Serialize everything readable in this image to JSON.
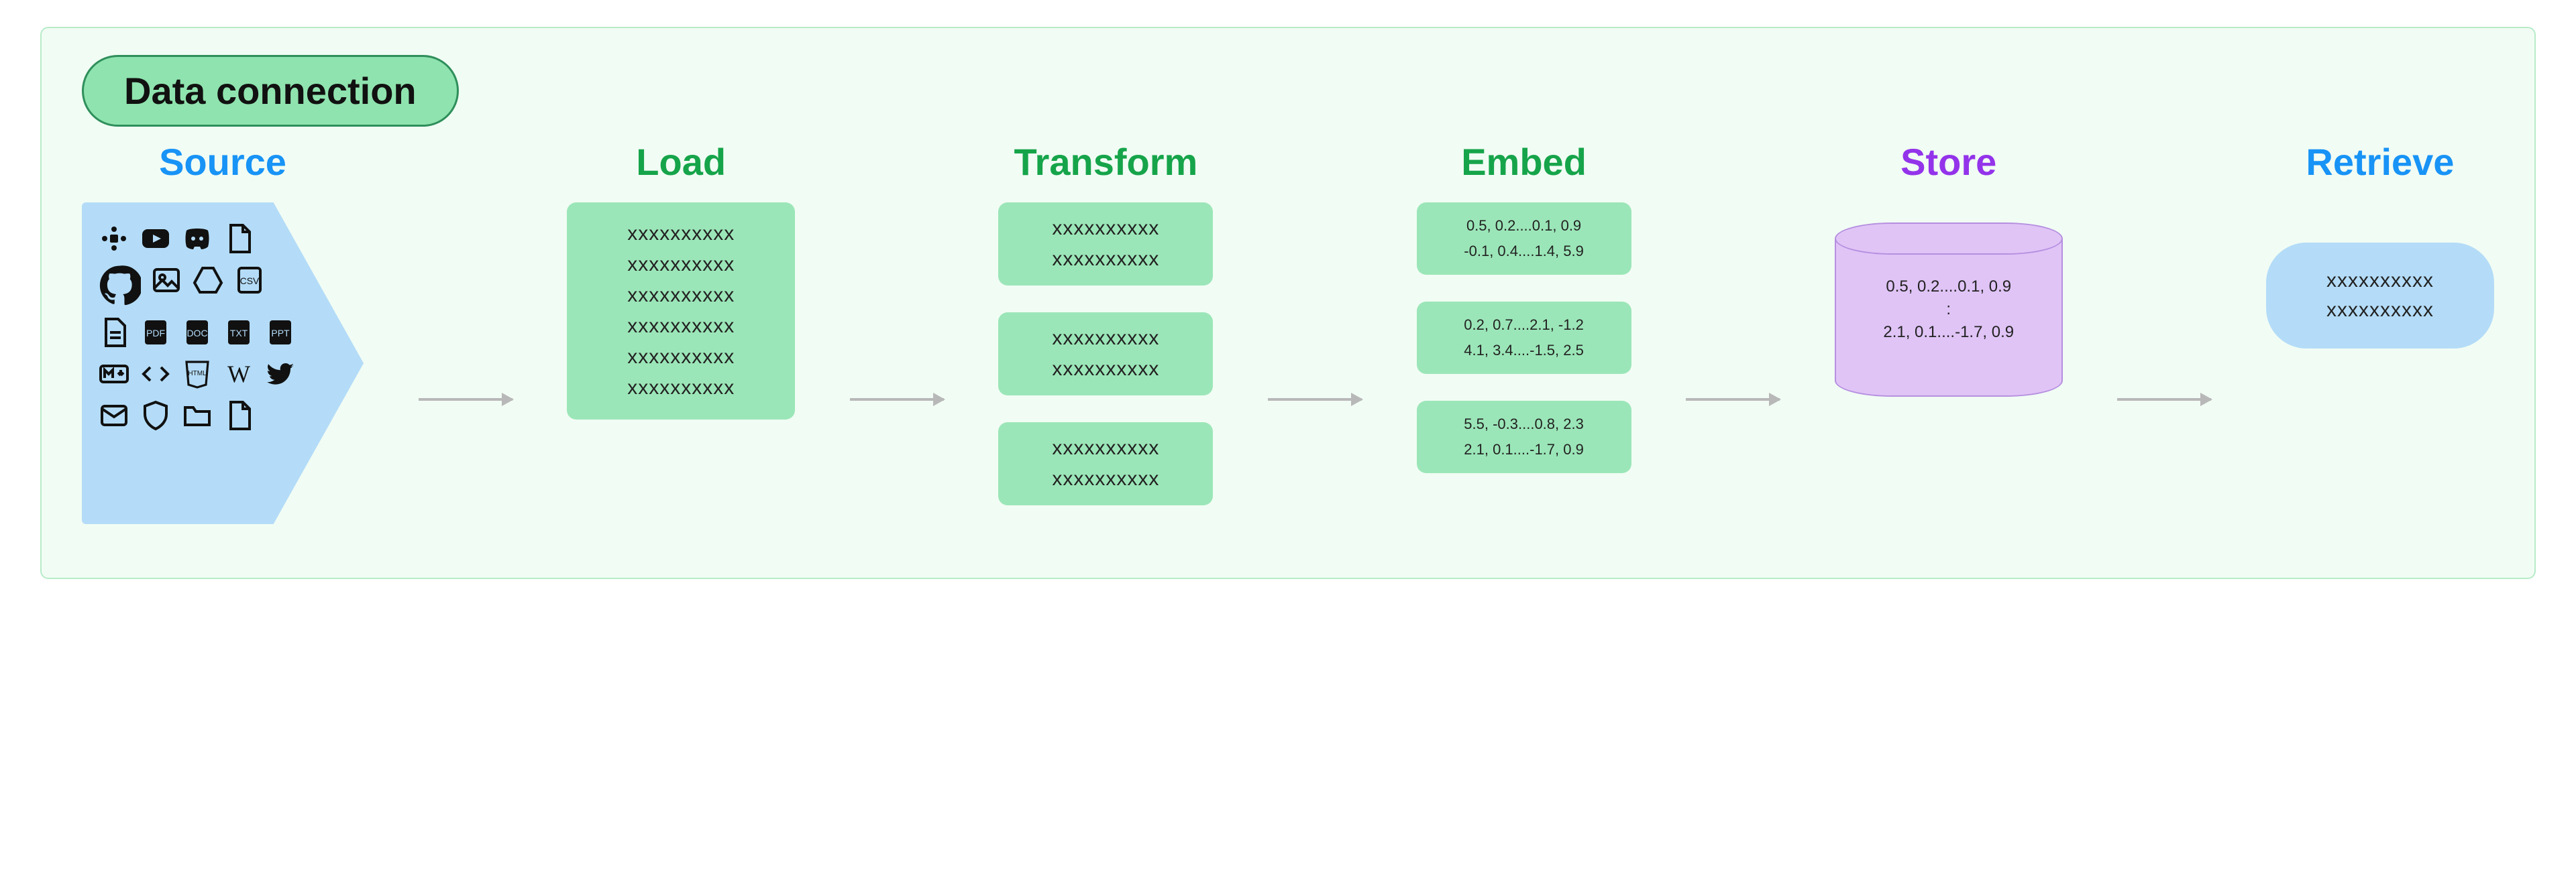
{
  "badge": "Data connection",
  "stages": {
    "source": {
      "title": "Source"
    },
    "load": {
      "title": "Load"
    },
    "transform": {
      "title": "Transform"
    },
    "embed": {
      "title": "Embed"
    },
    "store": {
      "title": "Store"
    },
    "retrieve": {
      "title": "Retrieve"
    }
  },
  "x": "xxxxxxxxxx",
  "load_lines": [
    "xxxxxxxxxx",
    "xxxxxxxxxx",
    "xxxxxxxxxx",
    "xxxxxxxxxx",
    "xxxxxxxxxx",
    "xxxxxxxxxx"
  ],
  "transform_chunks": [
    [
      "xxxxxxxxxx",
      "xxxxxxxxxx"
    ],
    [
      "xxxxxxxxxx",
      "xxxxxxxxxx"
    ],
    [
      "xxxxxxxxxx",
      "xxxxxxxxxx"
    ]
  ],
  "embed_vectors": [
    [
      "0.5, 0.2....0.1, 0.9",
      "-0.1, 0.4....1.4, 5.9"
    ],
    [
      "0.2, 0.7....2.1, -1.2",
      "4.1, 3.4....-1.5, 2.5"
    ],
    [
      "5.5, -0.3....0.8, 2.3",
      "2.1, 0.1....-1.7, 0.9"
    ]
  ],
  "store_lines": [
    "0.5, 0.2....0.1, 0.9",
    ":",
    "2.1, 0.1....-1.7, 0.9"
  ],
  "retrieve_lines": [
    "xxxxxxxxxx",
    "xxxxxxxxxx"
  ],
  "source_icons": [
    "slack",
    "youtube",
    "discord",
    "file",
    "github",
    "image",
    "gdrive",
    "csv",
    "pdf",
    "doc",
    "txt",
    "ppt",
    "page",
    "md",
    "code",
    "html",
    "wikipedia",
    "twitter",
    "mail",
    "shield",
    "folder",
    "file2"
  ]
}
